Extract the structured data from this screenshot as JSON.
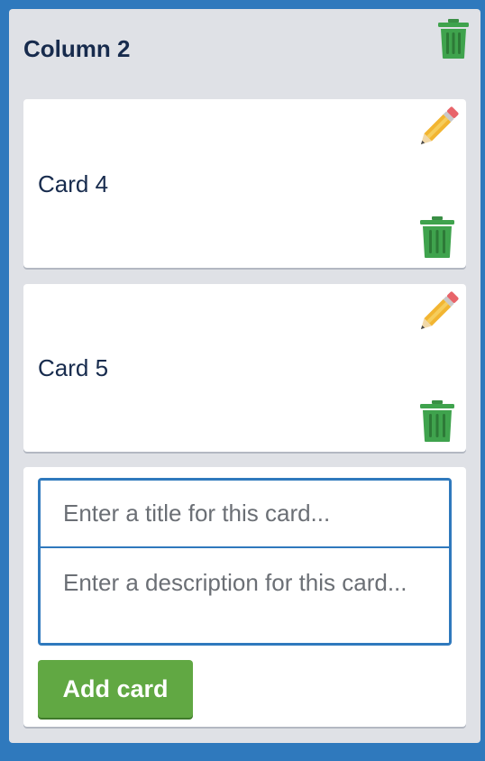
{
  "column": {
    "title": "Column 2",
    "delete_icon": "trash-icon"
  },
  "cards": [
    {
      "title": "Card 4",
      "edit_icon": "pencil-icon",
      "delete_icon": "trash-icon"
    },
    {
      "title": "Card 5",
      "edit_icon": "pencil-icon",
      "delete_icon": "trash-icon"
    }
  ],
  "add_form": {
    "title_placeholder": "Enter a title for this card...",
    "description_placeholder": "Enter a description for this card...",
    "submit_label": "Add card"
  },
  "colors": {
    "board_background": "#2f79bd",
    "column_background": "#dfe1e6",
    "card_background": "#ffffff",
    "text": "#172b4d",
    "trash_green": "#3fa34d",
    "add_button": "#61a843",
    "input_border": "#2f79bd"
  }
}
